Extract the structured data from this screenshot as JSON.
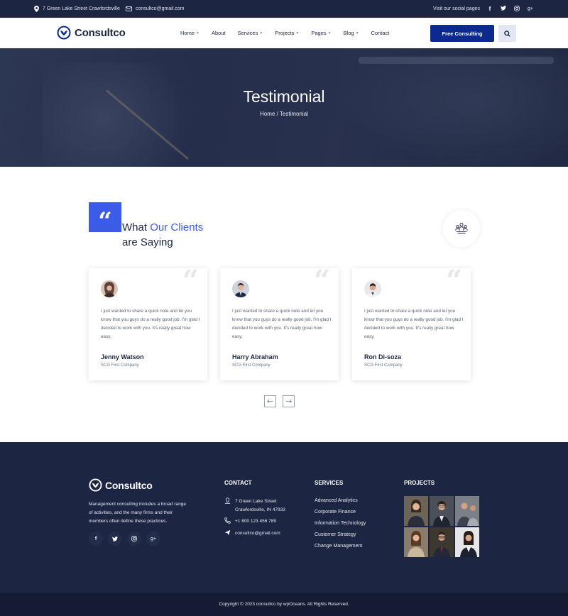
{
  "topbar": {
    "address": "7 Green Lake Street Crawfordsville",
    "email": "consultco@gmail.com",
    "social_label": "Visit our social pages",
    "social_icons": [
      "facebook-icon",
      "twitter-icon",
      "instagram-icon",
      "google-plus-icon"
    ]
  },
  "header": {
    "logo": "Consultco",
    "nav": [
      {
        "label": "Home",
        "dropdown": true
      },
      {
        "label": "About",
        "dropdown": false
      },
      {
        "label": "Services",
        "dropdown": true
      },
      {
        "label": "Projects",
        "dropdown": true
      },
      {
        "label": "Pages",
        "dropdown": true
      },
      {
        "label": "Blog",
        "dropdown": true
      },
      {
        "label": "Contact",
        "dropdown": false
      }
    ],
    "cta": "Free Consulting"
  },
  "hero": {
    "title": "Testimonial",
    "breadcrumb": "Home / Testimonial"
  },
  "section": {
    "quote_glyph": "“",
    "heading_part1": "What ",
    "heading_accent": "Our Clients",
    "heading_line2": "are Saying"
  },
  "testimonials": [
    {
      "text": "I just wanted to share a quick note and let you know that you guys do a really good job. I'm glad I decided to work with you. It's really great how easy.",
      "name": "Jenny Watson",
      "company": "SCG First Company"
    },
    {
      "text": "I just wanted to share a quick note and let you know that you guys do a really good job. I'm glad I decided to work with you. It's really great how easy.",
      "name": "Harry Abraham",
      "company": "SCG First Company"
    },
    {
      "text": "I just wanted to share a quick note and let you know that you guys do a really good job. I'm glad I decided to work with you. It's really great how easy.",
      "name": "Ron Di-soza",
      "company": "SCG First Company"
    }
  ],
  "footer": {
    "logo": "Consultco",
    "description": "Management consulting includes a broad range of activities, and the many firms and their members often define these practices.",
    "contact_heading": "CONTACT",
    "address_line1": "7 Green Lake Street",
    "address_line2": "Crawfordsville, IN 47933",
    "phone": "+1 800 123 456 789",
    "email": "consultco@gmail.com",
    "services_heading": "SERVICES",
    "services": [
      "Advanced Analytics",
      "Corporate Finance",
      "Information Technology",
      "Customer Strategy",
      "Change Management"
    ],
    "projects_heading": "PROJECTS",
    "copyright": "Copyright © 2023 consultco by wpOceans. All Rights Reserved."
  },
  "colors": {
    "navy": "#1c2541",
    "accent": "#3b5be8",
    "cta": "#0b2a8f"
  }
}
